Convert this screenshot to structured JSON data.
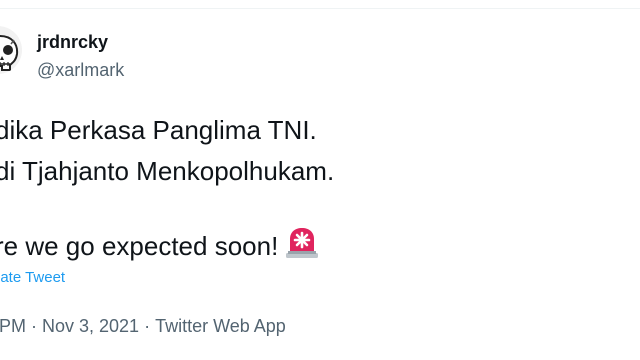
{
  "user": {
    "display_name": "jrdnrcky",
    "handle": "@xarlmark",
    "avatar_icon": "skull-avatar-icon"
  },
  "tweet": {
    "line1": "dika Perkasa Panglima TNI.",
    "line2": "di Tjahjanto Menkopolhukam.",
    "line3": "re we go expected soon!",
    "emoji_icon": "rotating-light-icon",
    "translate_label": "late Tweet"
  },
  "meta": {
    "time": "PM",
    "separator": "·",
    "date": "Nov 3, 2021",
    "source": "Twitter Web App"
  },
  "colors": {
    "text": "#0f1419",
    "secondary": "#536471",
    "link": "#1d9bf0",
    "siren": "#e0245e"
  }
}
